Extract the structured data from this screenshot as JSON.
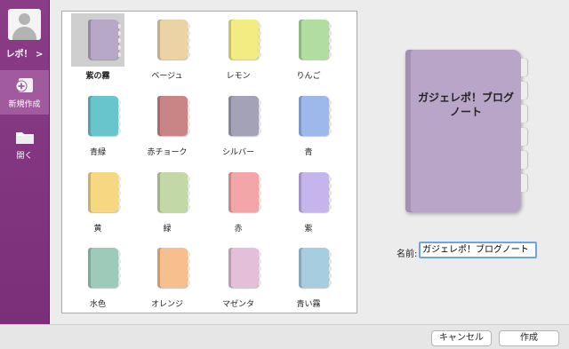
{
  "sidebar": {
    "user_label": "レポ！ >",
    "new_label": "新規作成",
    "open_label": "開く"
  },
  "colors": {
    "sidebar": "#7e3479",
    "sidebar_active": "#a25a9e",
    "input_focus": "#6da5df"
  },
  "notebooks": [
    {
      "label": "紫の霧",
      "color": "#b8a8c8",
      "selected": true
    },
    {
      "label": "ベージュ",
      "color": "#ecd3a6"
    },
    {
      "label": "レモン",
      "color": "#f3ec83"
    },
    {
      "label": "りんご",
      "color": "#b1dea0"
    },
    {
      "label": "青緑",
      "color": "#69c5cc"
    },
    {
      "label": "赤チョーク",
      "color": "#c98586"
    },
    {
      "label": "シルバー",
      "color": "#a3a2b7"
    },
    {
      "label": "青",
      "color": "#9db9ec"
    },
    {
      "label": "黄",
      "color": "#f6d882"
    },
    {
      "label": "緑",
      "color": "#c2d9a7"
    },
    {
      "label": "赤",
      "color": "#f3a6a8"
    },
    {
      "label": "紫",
      "color": "#c6b4ec"
    },
    {
      "label": "水色",
      "color": "#9ccbb9"
    },
    {
      "label": "オレンジ",
      "color": "#f7bf8e"
    },
    {
      "label": "マゼンタ",
      "color": "#e4bfd9"
    },
    {
      "label": "青い霧",
      "color": "#a7cde0"
    }
  ],
  "preview": {
    "title": "ガジェレポ！ブログノート"
  },
  "name_field": {
    "label": "名前:",
    "value": "ガジェレポ！ブログノート"
  },
  "buttons": {
    "cancel": "キャンセル",
    "create": "作成"
  }
}
